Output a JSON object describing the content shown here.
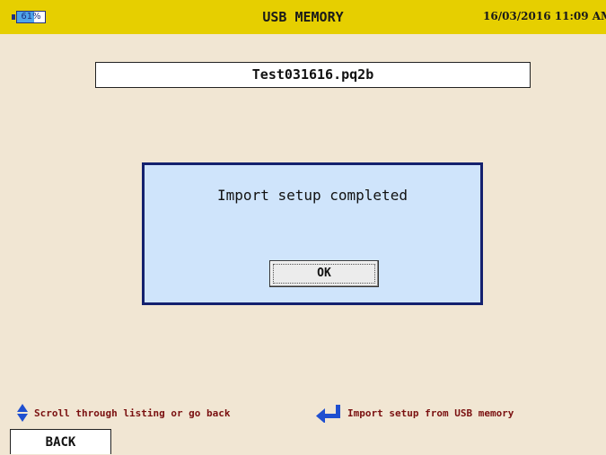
{
  "header": {
    "battery_label": "61%",
    "battery_level": 0.61,
    "title": "USB MEMORY",
    "datetime": "16/03/2016 11:09 AM"
  },
  "file": {
    "name": "Test031616.pq2b"
  },
  "dialog": {
    "message": "Import setup completed",
    "ok_label": "OK"
  },
  "hints": {
    "scroll": "Scroll through listing or go back",
    "enter": "Import setup from USB memory"
  },
  "footer": {
    "back_label": "BACK"
  },
  "icons": {
    "battery": "battery-icon",
    "scroll": "up-down-arrows-icon",
    "enter": "enter-key-icon"
  },
  "colors": {
    "title_bar": "#e6cf00",
    "background": "#f1e6d3",
    "dialog_bg": "#cfe4fb",
    "dialog_border": "#14216e",
    "hint_text": "#7a1010",
    "icon_blue": "#1f4fd0"
  }
}
